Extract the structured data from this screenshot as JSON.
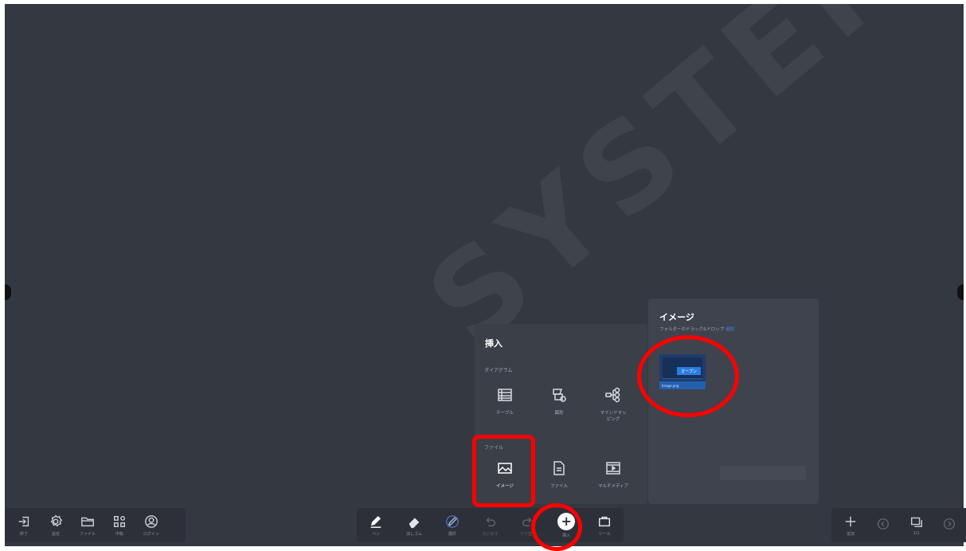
{
  "watermark": "SYSTEM",
  "toolbar_left": {
    "items": [
      {
        "icon": "exit-icon",
        "label": "終了"
      },
      {
        "icon": "gear-icon",
        "label": "設定"
      },
      {
        "icon": "folder-icon",
        "label": "ファイル"
      },
      {
        "icon": "apps-icon",
        "label": "中転"
      },
      {
        "icon": "user-icon",
        "label": "ログイン"
      }
    ]
  },
  "toolbar_center": {
    "items": [
      {
        "icon": "pen-icon",
        "label": "ペン"
      },
      {
        "icon": "eraser-icon",
        "label": "消しゴム"
      },
      {
        "icon": "select-icon",
        "label": "選択"
      },
      {
        "icon": "undo-icon",
        "label": "元に戻す"
      },
      {
        "icon": "redo-icon",
        "label": "やり直し"
      },
      {
        "icon": "insert-icon",
        "label": "挿入"
      },
      {
        "icon": "tools-icon",
        "label": "ツール"
      }
    ]
  },
  "toolbar_right": {
    "items": [
      {
        "icon": "add-page-icon",
        "label": "追加"
      },
      {
        "icon": "prev-page-icon",
        "label": ""
      },
      {
        "icon": "pages-icon",
        "label": "1/1"
      },
      {
        "icon": "next-page-icon",
        "label": ""
      }
    ]
  },
  "insert_panel": {
    "title": "挿入",
    "diagram_section": "ダイアグラム",
    "diagram_items": [
      {
        "icon": "table-icon",
        "label": "テーブル"
      },
      {
        "icon": "shapes-icon",
        "label": "図形"
      },
      {
        "icon": "mindmap-icon",
        "label": "マインドマッ\nピング"
      }
    ],
    "file_section": "ファイル",
    "file_items": [
      {
        "icon": "image-icon",
        "label": "イメージ"
      },
      {
        "icon": "document-icon",
        "label": "ファイル"
      },
      {
        "icon": "media-icon",
        "label": "マルチメディア"
      }
    ]
  },
  "image_panel": {
    "title": "イメージ",
    "subtitle": "フォルダーのドラッグ&ドロップ",
    "subtitle_link": "追加",
    "thumb_button": "オープン",
    "thumb_caption": "Image.png"
  },
  "colors": {
    "canvas": "#343841",
    "toolbar": "#2d3038",
    "panel": "#3b3f48",
    "annotation": "#ff0000",
    "accent": "#2b7ce0"
  }
}
